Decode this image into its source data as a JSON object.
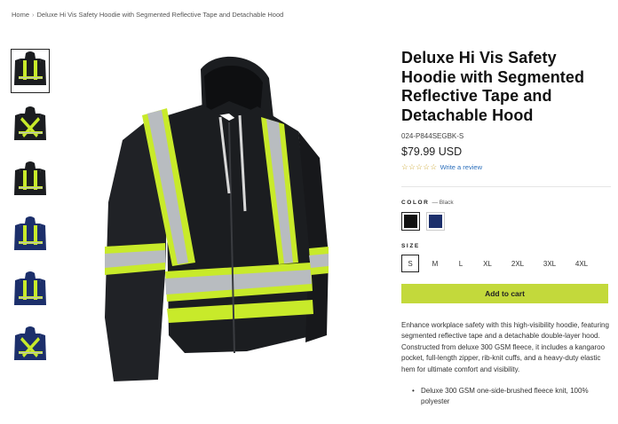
{
  "breadcrumb": {
    "home": "Home",
    "separator": "›",
    "current": "Deluxe Hi Vis Safety Hoodie with Segmented Reflective Tape and Detachable Hood"
  },
  "product": {
    "title": "Deluxe Hi Vis Safety Hoodie with Segmented Reflective Tape and Detachable Hood",
    "sku": "024-P844SEGBK-S",
    "price": "$79.99 USD",
    "stars": "☆☆☆☆☆",
    "review_link": "Write a review"
  },
  "color": {
    "label": "COLOR",
    "selected": "— Black",
    "swatches": [
      {
        "name": "Black",
        "hex": "#111111"
      },
      {
        "name": "Navy",
        "hex": "#1c2f6b"
      }
    ]
  },
  "size": {
    "label": "SIZE",
    "options": [
      "S",
      "M",
      "L",
      "XL",
      "2XL",
      "3XL",
      "4XL"
    ],
    "selected": "S"
  },
  "add_to_cart": "Add to cart",
  "description": "Enhance workplace safety with this high-visibility hoodie, featuring segmented reflective tape and a detachable double-layer hood. Constructed from deluxe 300 GSM fleece, it includes a kangaroo pocket, full-length zipper, rib-knit cuffs, and a heavy-duty elastic hem for ultimate comfort and visibility.",
  "features": [
    "Deluxe 300 GSM one-side-brushed fleece knit, 100% polyester"
  ],
  "colors": {
    "accent": "#c3d93b",
    "link": "#2a6ebb",
    "star": "#c9a227",
    "hoodie_black": "#1b1d20",
    "hoodie_navy": "#1c2f6b",
    "hivis_yellow": "#c8ea2a",
    "reflective_silver": "#b8bcc0"
  },
  "thumbnails": [
    {
      "icon": "hoodie-black-front-icon",
      "active": true
    },
    {
      "icon": "hoodie-black-back-icon",
      "active": false
    },
    {
      "icon": "hoodie-black-side-icon",
      "active": false
    },
    {
      "icon": "hoodie-navy-front-icon",
      "active": false
    },
    {
      "icon": "hoodie-navy-open-icon",
      "active": false
    },
    {
      "icon": "hoodie-navy-back-icon",
      "active": false
    }
  ]
}
